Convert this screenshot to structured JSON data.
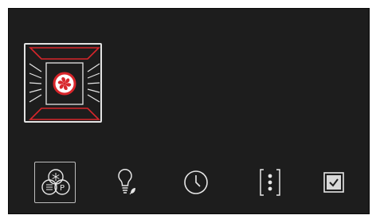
{
  "panel": {
    "background_color": "#1d1d1d",
    "accent_color": "#d8262b",
    "icon_color": "#e6e6e6"
  },
  "selected_mode": {
    "icon": "convection-fan-icon",
    "selected": true
  },
  "toolbar": {
    "buttons": [
      {
        "icon": "oven-functions-icon",
        "active": true
      },
      {
        "icon": "oven-light-eco-icon",
        "active": false
      },
      {
        "icon": "clock-icon",
        "active": false
      },
      {
        "icon": "more-menu-icon",
        "active": false
      },
      {
        "icon": "checkbox-checked-icon",
        "active": false
      }
    ]
  }
}
